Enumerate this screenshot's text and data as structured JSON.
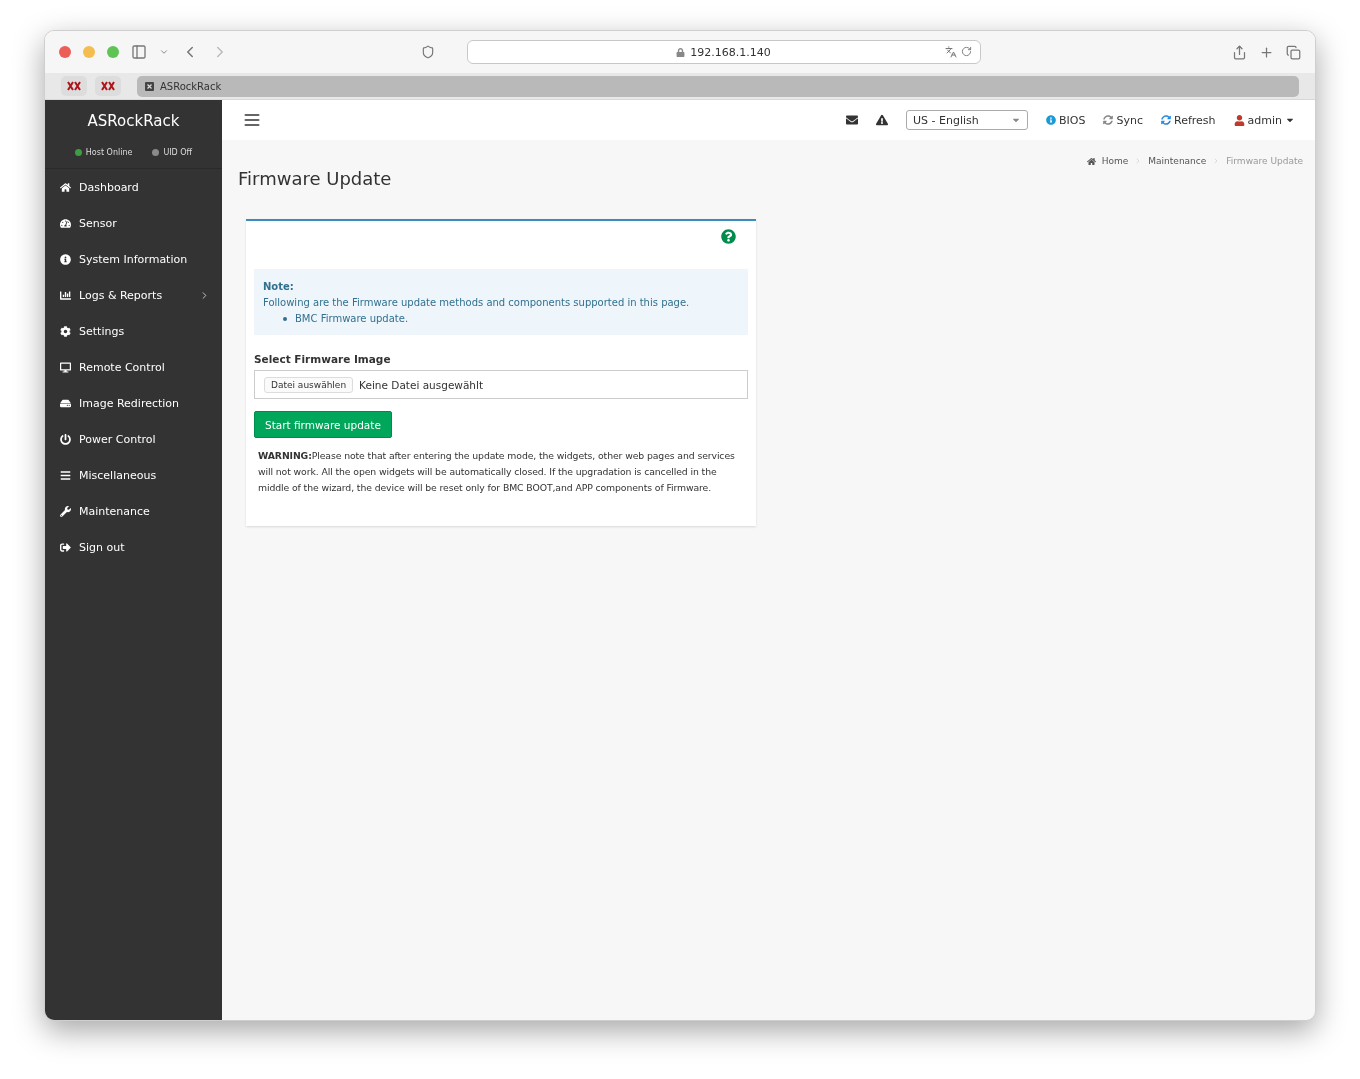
{
  "browser": {
    "address": "192.168.1.140",
    "tab_title": "ASRockRack"
  },
  "sidebar": {
    "brand": "ASRockRack",
    "status": [
      {
        "label": "Host Online",
        "color": "#3e9c43"
      },
      {
        "label": "UID Off",
        "color": "#8a8a8a"
      }
    ],
    "items": [
      {
        "label": "Dashboard",
        "selected": false,
        "submenu": false
      },
      {
        "label": "Sensor",
        "selected": false,
        "submenu": false
      },
      {
        "label": "System Information",
        "selected": false,
        "submenu": false
      },
      {
        "label": "Logs & Reports",
        "selected": false,
        "submenu": true
      },
      {
        "label": "Settings",
        "selected": false,
        "submenu": false
      },
      {
        "label": "Remote Control",
        "selected": false,
        "submenu": false
      },
      {
        "label": "Image Redirection",
        "selected": false,
        "submenu": false
      },
      {
        "label": "Power Control",
        "selected": false,
        "submenu": false
      },
      {
        "label": "Miscellaneous",
        "selected": false,
        "submenu": false
      },
      {
        "label": "Maintenance",
        "selected": false,
        "submenu": false
      },
      {
        "label": "Sign out",
        "selected": false,
        "submenu": false
      }
    ]
  },
  "header": {
    "language": "US - English",
    "links": [
      "BIOS",
      "Sync",
      "Refresh"
    ],
    "user": "admin"
  },
  "page": {
    "title": "Firmware Update",
    "breadcrumb": [
      "Home",
      "Maintenance",
      "Firmware Update"
    ],
    "note": {
      "heading": "Note:",
      "text": "Following are the Firmware update methods and components supported in this page.",
      "bullets": [
        "BMC Firmware update."
      ]
    },
    "field_label": "Select Firmware Image",
    "file_button": "Datei auswählen",
    "file_status": "Keine Datei ausgewählt",
    "submit": "Start firmware update",
    "warning": "**WARNING:**Please note that after entering the update mode, the widgets, other web pages and services will not work. All the open widgets will be automatically closed. If the upgradation is cancelled in the middle of the wizard, the device will be reset only for BMC BOOT,and APP components of Firmware."
  }
}
